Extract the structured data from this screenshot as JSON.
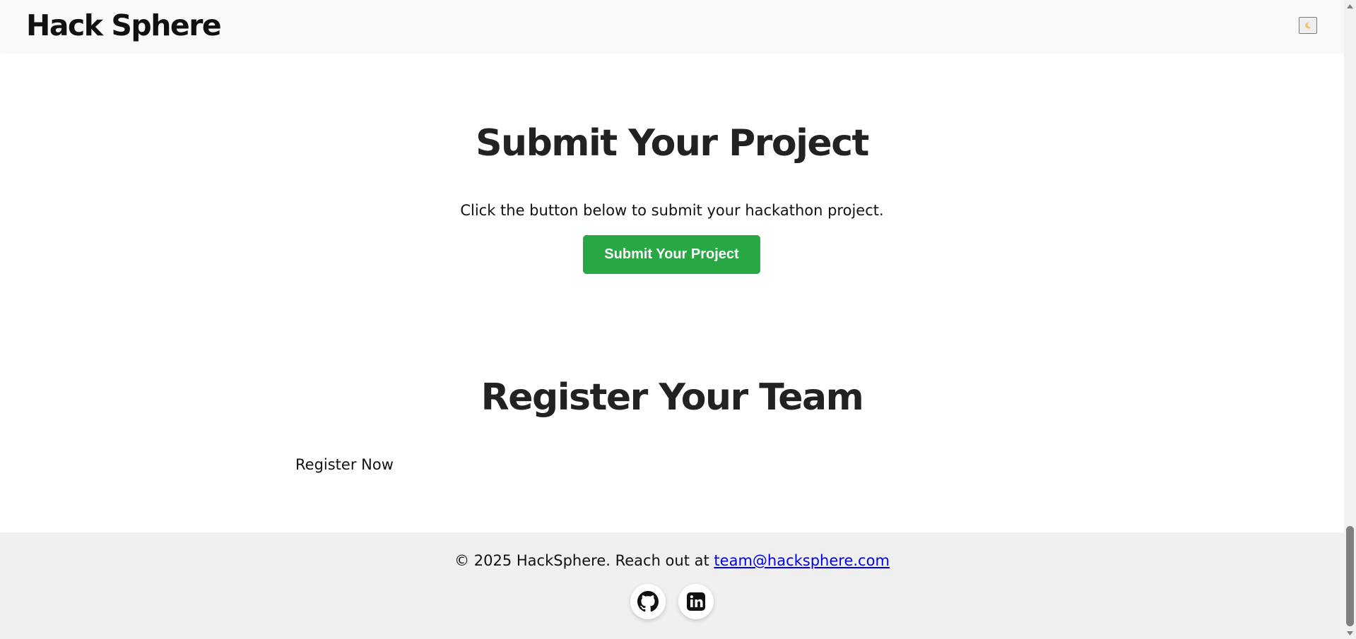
{
  "header": {
    "brand": "Hack Sphere",
    "theme_toggle_icon": "moon-icon"
  },
  "submit": {
    "title": "Submit Your Project",
    "description": "Click the button below to submit your hackathon project.",
    "button_label": "Submit Your Project",
    "button_color": "#28a745"
  },
  "register": {
    "title": "Register Your Team",
    "link_label": "Register Now"
  },
  "footer": {
    "copyright": "© 2025 HackSphere. Reach out at",
    "email": "team@hacksphere.com",
    "social": [
      {
        "icon": "github-icon"
      },
      {
        "icon": "linkedin-icon"
      }
    ]
  },
  "colors": {
    "header_bg": "#f8f9fa",
    "footer_bg": "#f0f0f0",
    "link": "#0000ee",
    "heading": "#222222"
  }
}
